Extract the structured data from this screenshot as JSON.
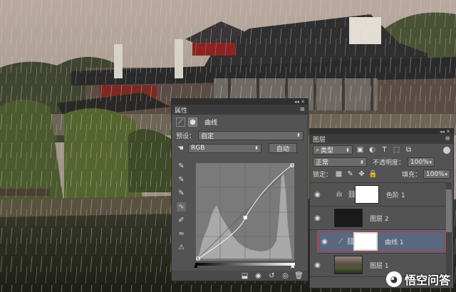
{
  "properties": {
    "title": "属性",
    "adjustment_name": "曲线",
    "preset_label": "预设：",
    "preset_value": "自定",
    "channel_value": "RGB",
    "auto_button": "自动"
  },
  "layers_panel": {
    "title": "图层",
    "filter_kind": "类型",
    "blend_mode": "正常",
    "opacity_label": "不透明度：",
    "opacity_value": "100%",
    "lock_label": "锁定：",
    "fill_label": "填充：",
    "fill_value": "100%",
    "layers": [
      {
        "name": "色阶 1",
        "kind": "adjustment-levels",
        "visible": true,
        "selected": false
      },
      {
        "name": "图层 2",
        "kind": "pixel-dark",
        "visible": true,
        "selected": false
      },
      {
        "name": "曲线 1",
        "kind": "adjustment-curves",
        "visible": true,
        "selected": true
      },
      {
        "name": "图层 1",
        "kind": "pixel-photo",
        "visible": true,
        "selected": false
      }
    ]
  },
  "curve": {
    "points": [
      [
        0,
        0
      ],
      [
        128,
        112
      ],
      [
        255,
        255
      ]
    ]
  },
  "watermark": {
    "text": "悟空问答"
  },
  "colors": {
    "panel_bg": "#535353",
    "title_bar": "#3c3c3c",
    "selected_layer": "#59677f"
  }
}
